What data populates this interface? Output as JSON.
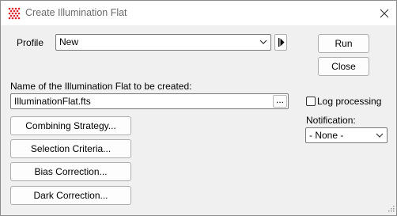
{
  "window": {
    "title": "Create Illumination Flat"
  },
  "profile": {
    "label": "Profile",
    "value": "New"
  },
  "buttons": {
    "run": "Run",
    "close": "Close"
  },
  "name_field": {
    "label": "Name of the Illumination Flat to be created:",
    "value": "IlluminationFlat.fts",
    "browse": "..."
  },
  "log_processing": {
    "label": "Log processing",
    "checked": false
  },
  "notification": {
    "label": "Notification:",
    "value": "- None -"
  },
  "actions": {
    "combining_strategy": "Combining Strategy...",
    "selection_criteria": "Selection Criteria...",
    "bias_correction": "Bias Correction...",
    "dark_correction": "Dark Correction..."
  },
  "colors": {
    "app_icon": "#d9232e",
    "window_border": "#8c8c8c",
    "field_border": "#7a7a7a"
  }
}
